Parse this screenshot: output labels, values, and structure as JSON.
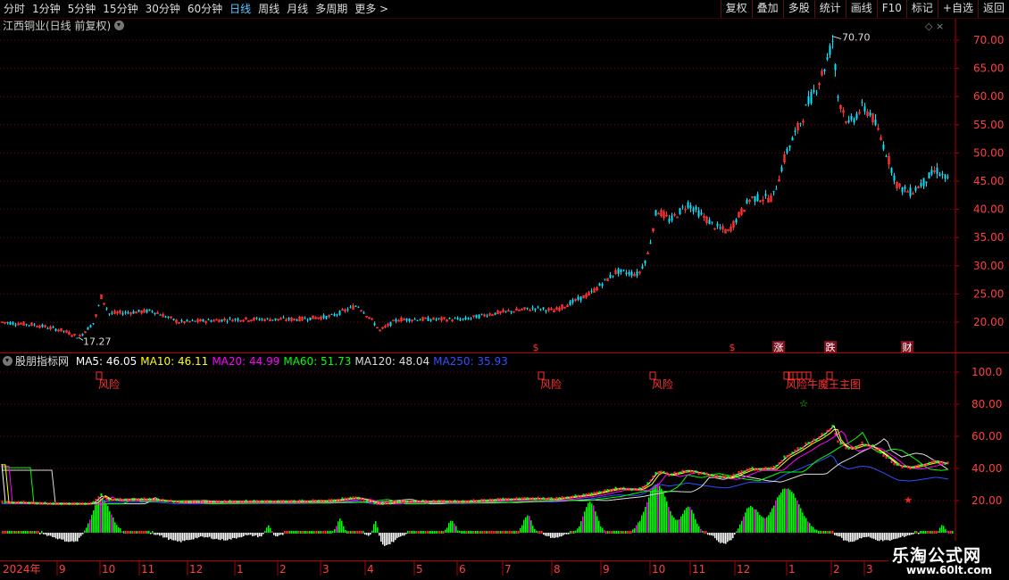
{
  "toolbar": {
    "periods": [
      "分时",
      "1分钟",
      "5分钟",
      "15分钟",
      "30分钟",
      "60分钟",
      "日线",
      "周线",
      "月线",
      "多周期",
      "更多"
    ],
    "active_period": "日线",
    "more_arrow": ">",
    "right_buttons": [
      "复权",
      "叠加",
      "多股",
      "统计",
      "画线",
      "F10",
      "标记",
      "+自选",
      "返回"
    ]
  },
  "main_chart": {
    "title": "江西铜业(日线 前复权)",
    "corner_icons": "◇ ×",
    "price_axis": [
      "70.00",
      "65.00",
      "60.00",
      "55.00",
      "50.00",
      "45.00",
      "40.00",
      "35.00",
      "30.00",
      "25.00",
      "20.00"
    ],
    "price_ticks": [
      70,
      65,
      60,
      55,
      50,
      45,
      40,
      35,
      30,
      25,
      20
    ],
    "high_label": "70.70",
    "low_label": "17.27",
    "high_value": 70.7,
    "low_value": 17.27,
    "event_markers": [
      {
        "label": "$",
        "color": "#ff3030"
      },
      {
        "label": "$",
        "color": "#ff3030"
      },
      {
        "label": "涨",
        "color": "#ffffff"
      },
      {
        "label": "跌",
        "color": "#ffffff"
      },
      {
        "label": "财",
        "color": "#ffffff"
      }
    ]
  },
  "indicator": {
    "name": "股朋指标网",
    "ma_labels": [
      {
        "label": "MA5: 46.05",
        "color": "#ffffff"
      },
      {
        "label": "MA10: 46.11",
        "color": "#ffff00"
      },
      {
        "label": "MA20: 44.99",
        "color": "#ff00ff"
      },
      {
        "label": "MA60: 51.73",
        "color": "#00ff00"
      },
      {
        "label": "MA120: 48.04",
        "color": "#dddddd"
      },
      {
        "label": "MA250: 35.93",
        "color": "#3050ff"
      }
    ],
    "axis": [
      "100.0",
      "80.00",
      "60.00",
      "40.00",
      "20.00"
    ],
    "axis_ticks": [
      100,
      80,
      60,
      40,
      20
    ],
    "annotations": [
      {
        "label": "风险",
        "color": "#ff3030"
      },
      {
        "label": "风险",
        "color": "#ff3030"
      },
      {
        "label": "风险",
        "color": "#ff3030"
      },
      {
        "label": "风险牛魔王主图",
        "color": "#ff3030"
      }
    ],
    "star_green": "☆",
    "star_red": "★"
  },
  "time_axis": {
    "year_label": "2024年",
    "months": [
      "9",
      "10",
      "11",
      "12",
      "1",
      "2",
      "3",
      "4",
      "5",
      "6",
      "7",
      "8",
      "9",
      "10",
      "11",
      "12",
      "1",
      "2",
      "3"
    ]
  },
  "watermark": {
    "main": "乐淘公式网",
    "sub": "www.60lt.com"
  },
  "colors": {
    "up": "#ff3030",
    "down": "#00e5ff",
    "grid": "#7a0000",
    "axis_text": "#ff4040"
  }
}
